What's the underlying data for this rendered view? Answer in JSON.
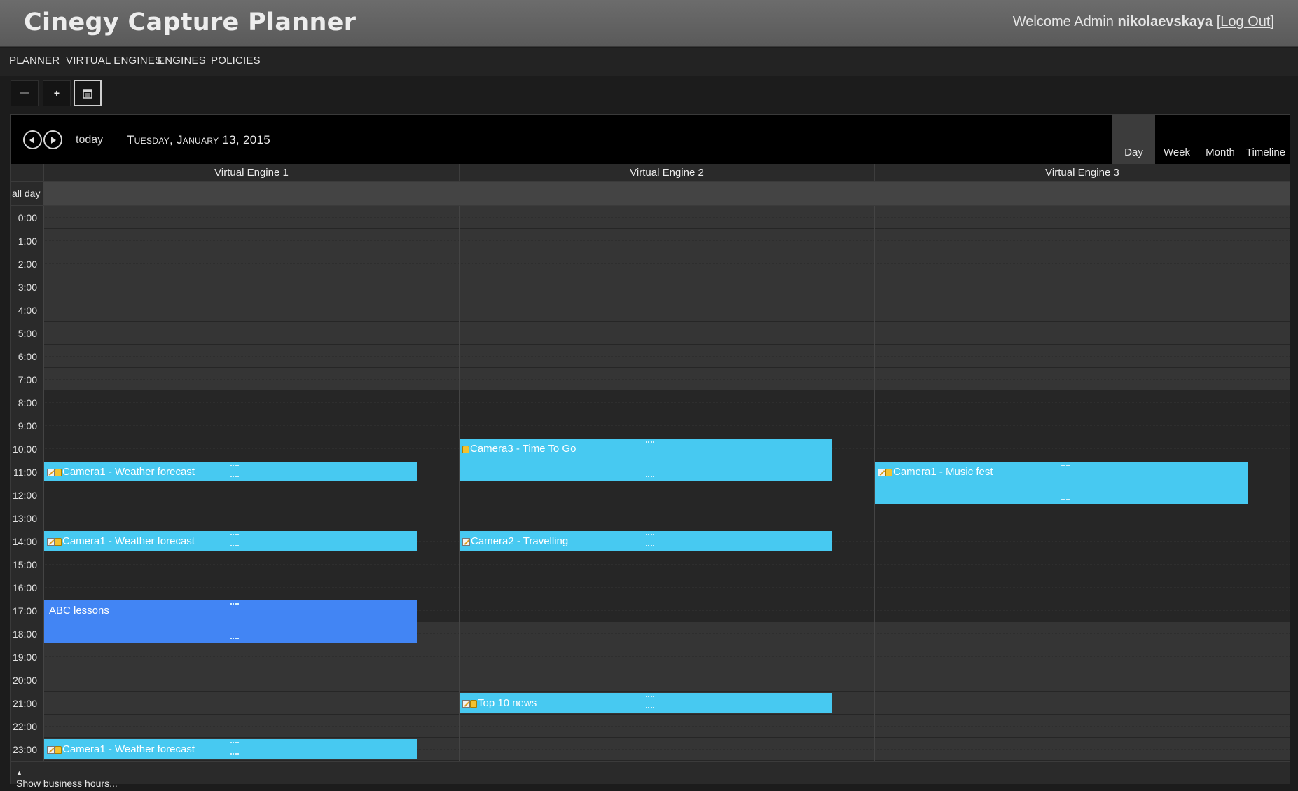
{
  "header": {
    "title": "Cinegy Capture Planner",
    "welcome_prefix": "Welcome Admin",
    "username": "nikolaevskaya",
    "logout_label": "Log Out"
  },
  "nav": [
    "PLANNER",
    "VIRTUAL ENGINES",
    "ENGINES",
    "POLICIES"
  ],
  "toolbar": {
    "remove_icon": "minus-icon",
    "add_icon": "plus-icon",
    "calendar_icon": "calendar-icon"
  },
  "calendar": {
    "today_label": "today",
    "date_label": "Tuesday, January 13, 2015",
    "views": [
      "Day",
      "Week",
      "Month",
      "Timeline"
    ],
    "selected_view": "Day",
    "columns": [
      "Virtual Engine 1",
      "Virtual Engine 2",
      "Virtual Engine 3"
    ],
    "allday_label": "all day",
    "hours": [
      "0:00",
      "1:00",
      "2:00",
      "3:00",
      "4:00",
      "5:00",
      "6:00",
      "7:00",
      "8:00",
      "9:00",
      "10:00",
      "11:00",
      "12:00",
      "13:00",
      "14:00",
      "15:00",
      "16:00",
      "17:00",
      "18:00",
      "19:00",
      "20:00",
      "21:00",
      "22:00",
      "23:00"
    ],
    "business_hours_start": 8,
    "business_hours_end": 18,
    "footer_label": "Show business hours...",
    "event_colors": {
      "recording": "#47c9f1",
      "lesson": "#4285f4"
    },
    "events": [
      {
        "column": 0,
        "start": 11,
        "end": 12,
        "title": "Camera1 - Weather forecast",
        "icons": [
          "edit",
          "lock"
        ],
        "style": "recording"
      },
      {
        "column": 0,
        "start": 14,
        "end": 15,
        "title": "Camera1 - Weather forecast",
        "icons": [
          "edit",
          "lock"
        ],
        "style": "recording"
      },
      {
        "column": 0,
        "start": 17,
        "end": 19,
        "title": "ABC lessons",
        "icons": [],
        "style": "lesson"
      },
      {
        "column": 0,
        "start": 23,
        "end": 24,
        "title": "Camera1 - Weather forecast",
        "icons": [
          "edit",
          "lock"
        ],
        "style": "recording"
      },
      {
        "column": 1,
        "start": 10,
        "end": 12,
        "title": "Camera3 - Time To Go",
        "icons": [
          "lock"
        ],
        "style": "recording"
      },
      {
        "column": 1,
        "start": 14,
        "end": 15,
        "title": "Camera2 - Travelling",
        "icons": [
          "edit"
        ],
        "style": "recording"
      },
      {
        "column": 1,
        "start": 21,
        "end": 22,
        "title": "Top 10 news",
        "icons": [
          "edit",
          "lock"
        ],
        "style": "recording"
      },
      {
        "column": 2,
        "start": 11,
        "end": 13,
        "title": "Camera1 - Music fest",
        "icons": [
          "edit",
          "lock"
        ],
        "style": "recording"
      }
    ]
  }
}
